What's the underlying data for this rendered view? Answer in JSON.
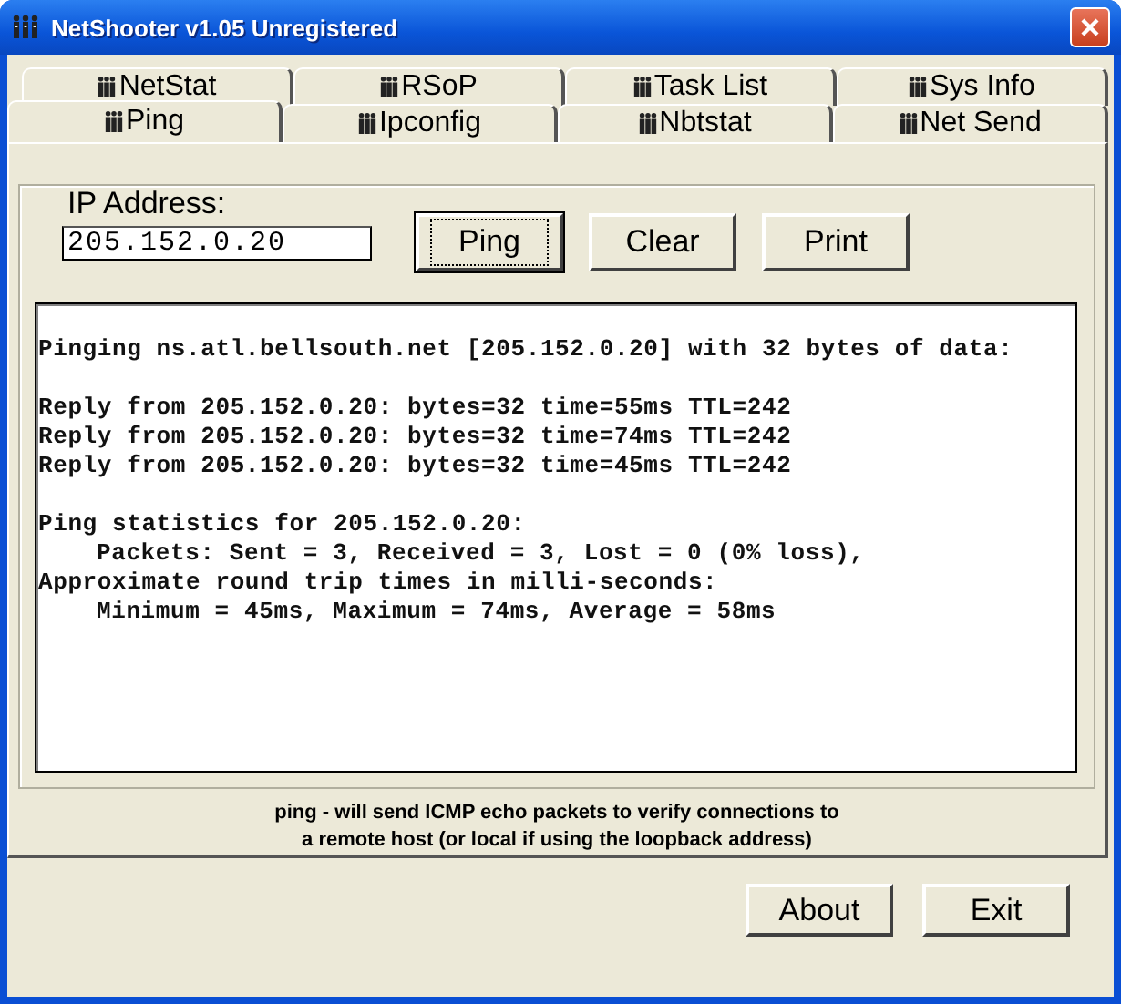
{
  "window": {
    "title": "NetShooter v1.05 Unregistered"
  },
  "tab_rows": [
    [
      {
        "label": "NetStat",
        "selected": false
      },
      {
        "label": "RSoP",
        "selected": false
      },
      {
        "label": "Task List",
        "selected": false
      },
      {
        "label": "Sys Info",
        "selected": false
      }
    ],
    [
      {
        "label": "Ping",
        "selected": true
      },
      {
        "label": "Ipconfig",
        "selected": false
      },
      {
        "label": "Nbtstat",
        "selected": false
      },
      {
        "label": "Net Send",
        "selected": false
      }
    ]
  ],
  "ip_field": {
    "label": "IP Address:",
    "value": "205.152.0.20"
  },
  "buttons": [
    {
      "label": "Ping",
      "focused": true
    },
    {
      "label": "Clear",
      "focused": false
    },
    {
      "label": "Print",
      "focused": false
    }
  ],
  "output": {
    "blocks": [
      [
        {
          "text": "Pinging ns.atl.bellsouth.net [205.152.0.20] with 32 bytes of data:",
          "indented": false
        }
      ],
      [
        {
          "text": "Reply from 205.152.0.20: bytes=32 time=55ms TTL=242",
          "indented": false
        },
        {
          "text": "Reply from 205.152.0.20: bytes=32 time=74ms TTL=242",
          "indented": false
        },
        {
          "text": "Reply from 205.152.0.20: bytes=32 time=45ms TTL=242",
          "indented": false
        }
      ],
      [
        {
          "text": "Ping statistics for 205.152.0.20:",
          "indented": false
        },
        {
          "text": "Packets: Sent = 3, Received = 3, Lost = 0 (0% loss),",
          "indented": true
        },
        {
          "text": "Approximate round trip times in milli-seconds:",
          "indented": false
        },
        {
          "text": "Minimum = 45ms, Maximum = 74ms, Average = 58ms",
          "indented": true
        }
      ]
    ]
  },
  "description": [
    "ping - will send ICMP echo packets to verify connections to",
    "a remote host (or local if using the loopback address)"
  ],
  "footer_buttons": [
    "About",
    "Exit"
  ]
}
